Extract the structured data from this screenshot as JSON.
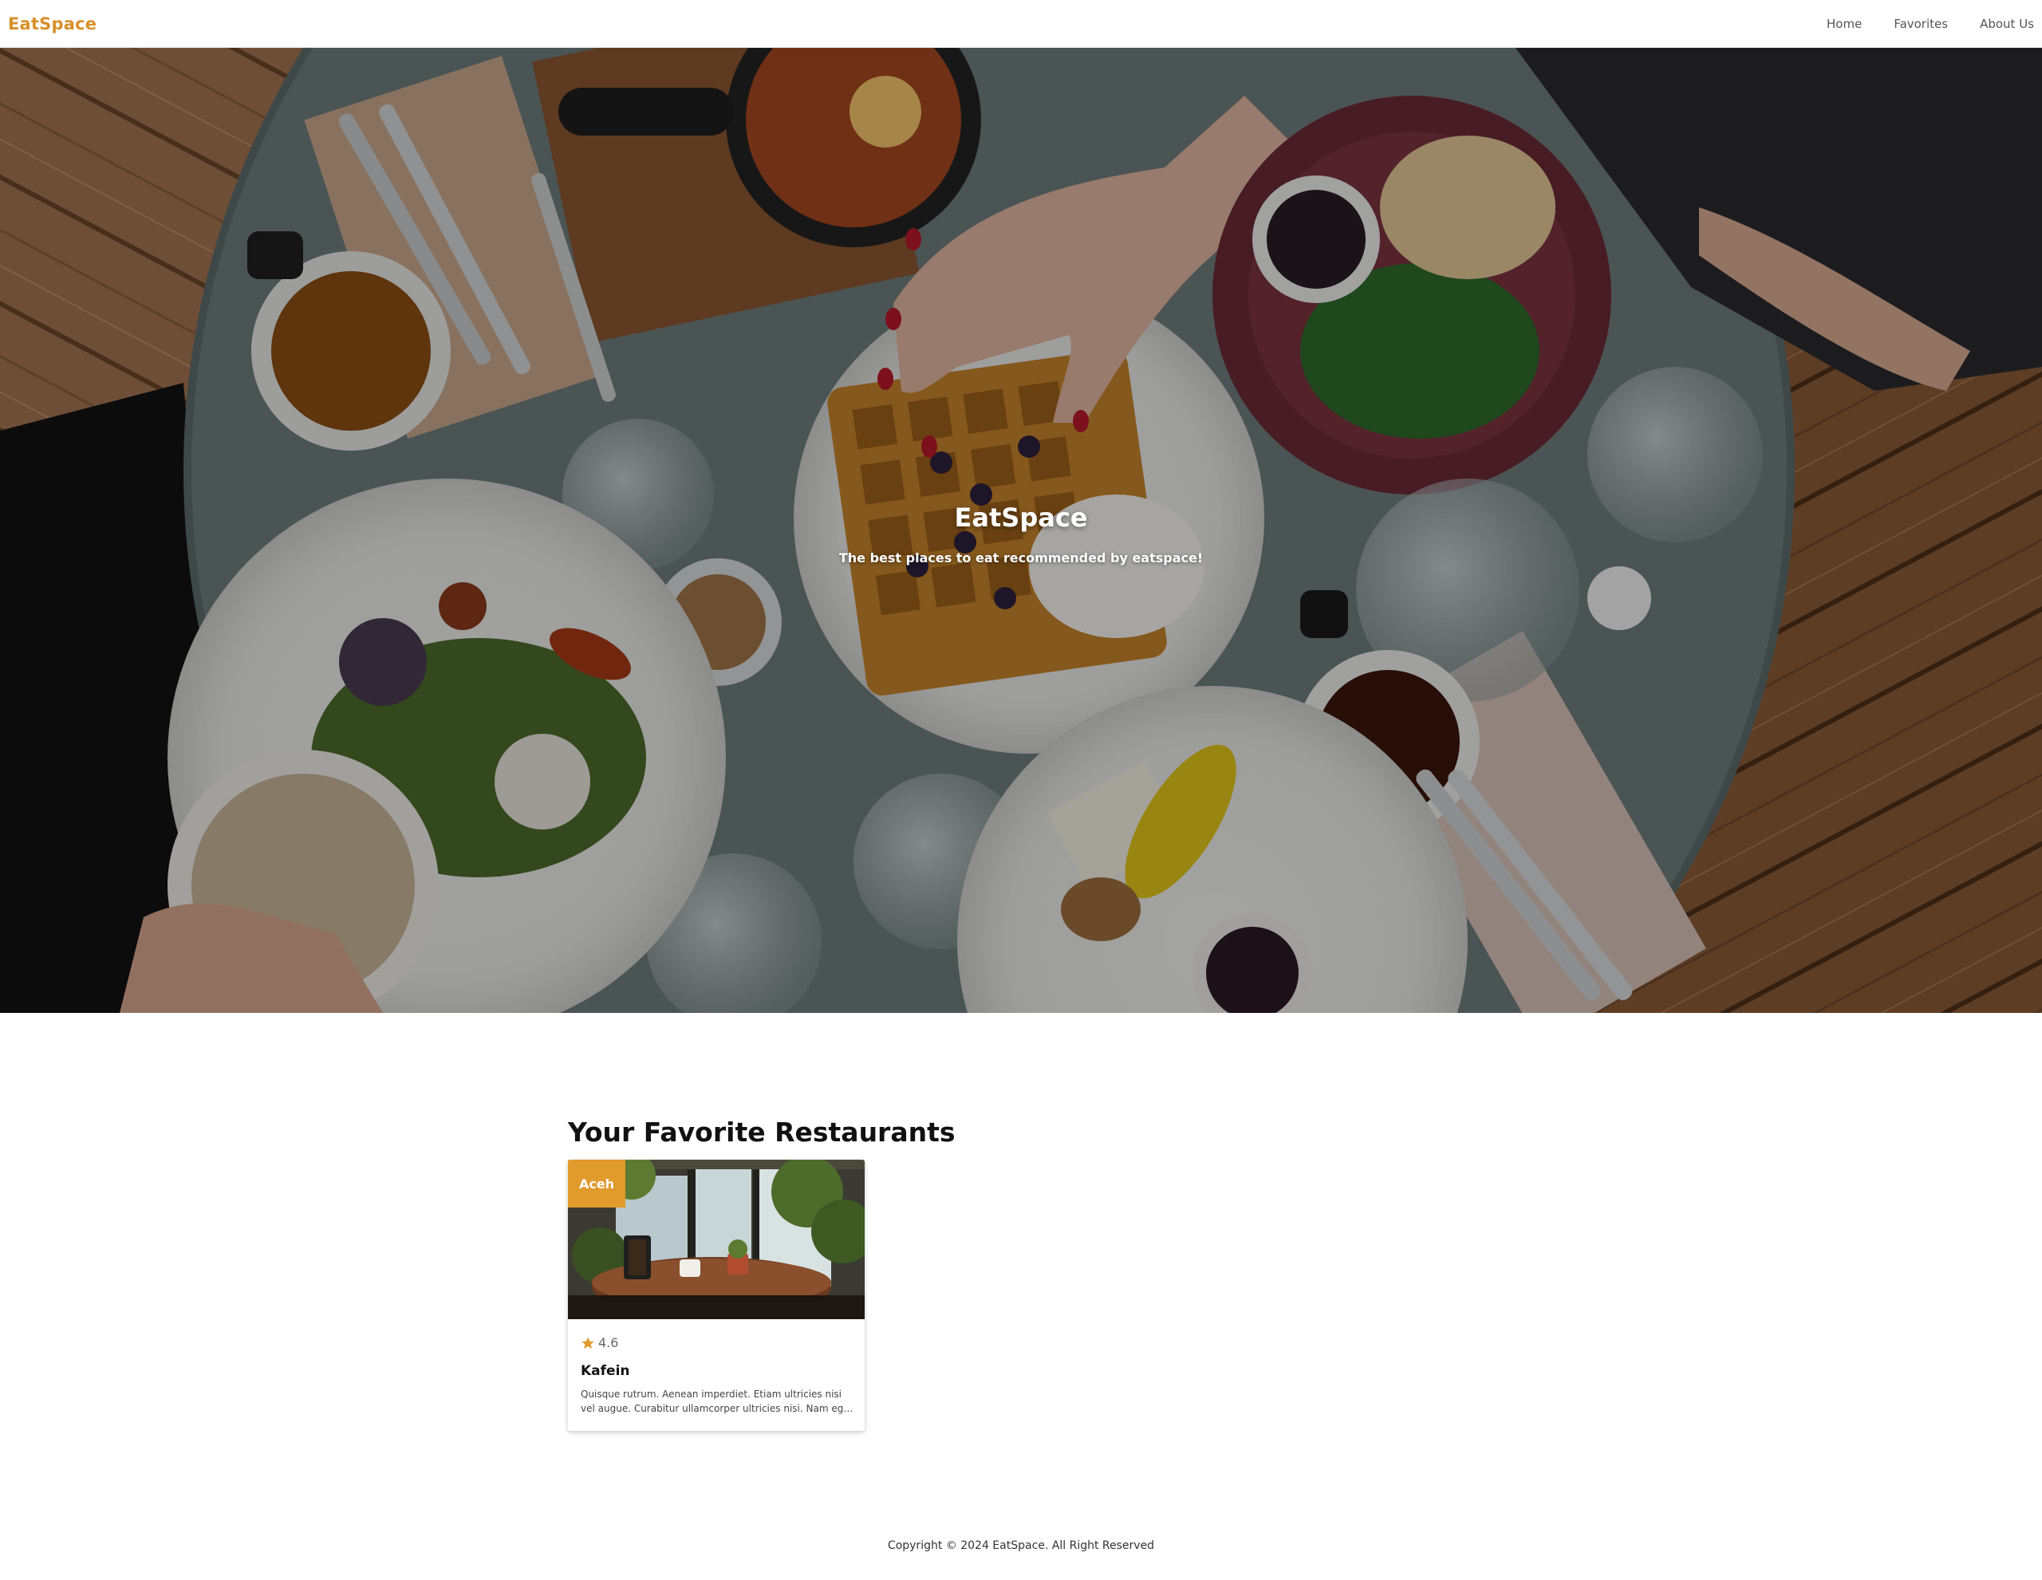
{
  "header": {
    "brand": "EatSpace",
    "nav": [
      {
        "label": "Home"
      },
      {
        "label": "Favorites"
      },
      {
        "label": "About Us"
      }
    ]
  },
  "hero": {
    "title": "EatSpace",
    "subtitle": "The best places to eat recommended by eatspace!"
  },
  "favorites": {
    "title": "Your Favorite Restaurants",
    "restaurants": [
      {
        "city": "Aceh",
        "rating": "4.6",
        "name": "Kafein",
        "description": "Quisque rutrum. Aenean imperdiet. Etiam ultricies nisi vel augue. Curabitur ullamcorper ultricies nisi. Nam eget dui."
      }
    ]
  },
  "footer": {
    "copyright": "Copyright © 2024 EatSpace. All Right Reserved"
  },
  "colors": {
    "brand": "#d8902a",
    "badge": "#e19a2c",
    "star": "#e19a2c"
  },
  "icons": {
    "rating": "star-icon"
  }
}
